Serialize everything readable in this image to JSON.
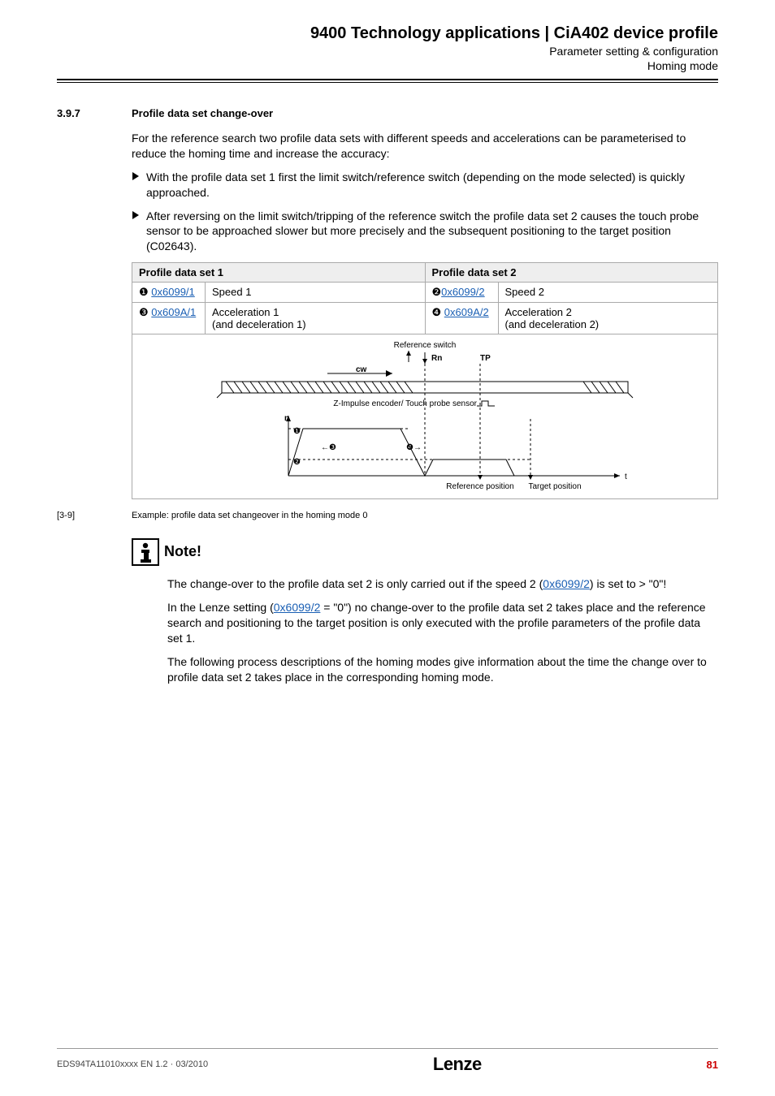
{
  "header": {
    "title": "9400 Technology applications | CiA402 device profile",
    "sub1": "Parameter setting & configuration",
    "sub2": "Homing mode"
  },
  "section": {
    "number": "3.9.7",
    "title": "Profile data set change-over"
  },
  "intro": "For the reference search two profile data sets with different speeds and accelerations can be parameterised to reduce the homing time and increase the accuracy:",
  "bullets": [
    "With the profile data set 1 first the limit switch/reference switch (depending on the mode selected) is quickly approached.",
    "After reversing on the limit switch/tripping of the reference switch the profile data set 2 causes the touch probe sensor to be approached slower but more precisely and the subsequent positioning to the target position (C02643)."
  ],
  "table": {
    "hdr1": "Profile data set 1",
    "hdr2": "Profile data set 2",
    "rows": [
      {
        "m1": "❶",
        "c1": "0x6099/1",
        "d1": "Speed 1",
        "m2": "❷",
        "c2": "0x6099/2",
        "d2": "Speed 2"
      },
      {
        "m1": "❸",
        "c1": "0x609A/1",
        "d1": "Acceleration 1\n(and deceleration 1)",
        "m2": "❹",
        "c2": "0x609A/2",
        "d2": "Acceleration 2\n(and deceleration 2)"
      }
    ]
  },
  "diagram": {
    "ref_switch": "Reference switch",
    "rn": "Rn",
    "tp": "TP",
    "cw": "cw",
    "n": "n",
    "zprobe": "Z-Impulse encoder/\nTouch probe sensor",
    "ref_pos": "Reference position",
    "tgt_pos": "Target position",
    "t": "t",
    "m1": "❶",
    "m2": "❷",
    "m3": "❸",
    "m4": "❹"
  },
  "caption": {
    "num": "[3-9]",
    "text": "Example: profile data set changeover in the homing mode 0"
  },
  "note": {
    "title": "Note!",
    "p1a": "The change-over to the profile data set 2 is only carried out if the speed 2 (",
    "p1link": "0x6099/2",
    "p1b": ") is set to > \"0\"!",
    "p2a": "In the Lenze setting (",
    "p2link": "0x6099/2",
    "p2b": " = \"0\") no change-over to the profile data set 2 takes place and the reference search and positioning to the target position is only executed with the profile parameters of the profile data set 1.",
    "p3": "The following process descriptions of the homing modes give information about the time the change over to profile data set 2 takes place in the corresponding homing mode."
  },
  "footer": {
    "doc": "EDS94TA11010xxxx EN 1.2 · 03/2010",
    "logo": "Lenze",
    "page": "81"
  }
}
